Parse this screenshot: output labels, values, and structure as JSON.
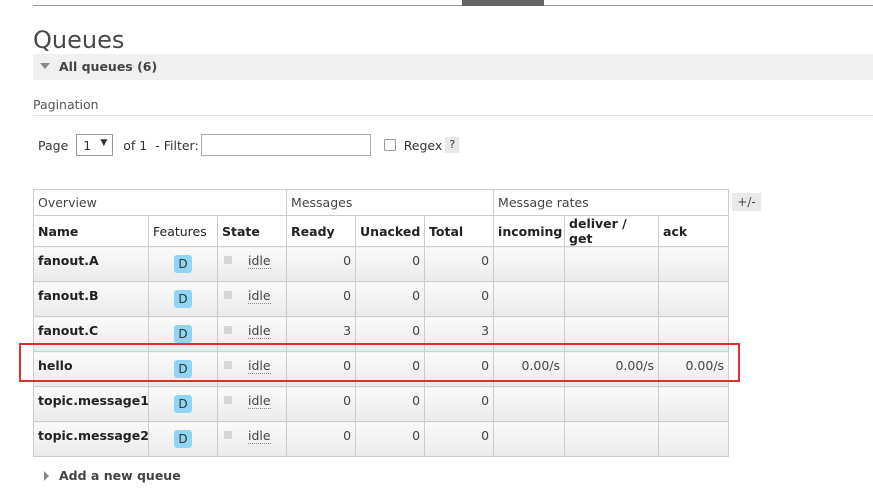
{
  "page_title": "Queues",
  "section": {
    "label": "All queues (6)"
  },
  "pagination": {
    "title": "Pagination",
    "page_label": "Page",
    "page_value": "1",
    "of_label": "of 1",
    "filter_label": "- Filter:",
    "filter_value": "",
    "regex_label": "Regex",
    "help_label": "?"
  },
  "table": {
    "groups": [
      "Overview",
      "Messages",
      "Message rates"
    ],
    "columns": [
      "Name",
      "Features",
      "State",
      "Ready",
      "Unacked",
      "Total",
      "incoming",
      "deliver / get",
      "ack"
    ],
    "rows": [
      {
        "name": "fanout.A",
        "feature": "D",
        "state": "idle",
        "ready": "0",
        "unacked": "0",
        "total": "0",
        "incoming": "",
        "deliver": "",
        "ack": ""
      },
      {
        "name": "fanout.B",
        "feature": "D",
        "state": "idle",
        "ready": "0",
        "unacked": "0",
        "total": "0",
        "incoming": "",
        "deliver": "",
        "ack": ""
      },
      {
        "name": "fanout.C",
        "feature": "D",
        "state": "idle",
        "ready": "3",
        "unacked": "0",
        "total": "3",
        "incoming": "",
        "deliver": "",
        "ack": ""
      },
      {
        "name": "hello",
        "feature": "D",
        "state": "idle",
        "ready": "0",
        "unacked": "0",
        "total": "0",
        "incoming": "0.00/s",
        "deliver": "0.00/s",
        "ack": "0.00/s"
      },
      {
        "name": "topic.message1",
        "feature": "D",
        "state": "idle",
        "ready": "0",
        "unacked": "0",
        "total": "0",
        "incoming": "",
        "deliver": "",
        "ack": ""
      },
      {
        "name": "topic.message2",
        "feature": "D",
        "state": "idle",
        "ready": "0",
        "unacked": "0",
        "total": "0",
        "incoming": "",
        "deliver": "",
        "ack": ""
      }
    ],
    "toggle_columns_label": "+/-"
  },
  "add_queue": {
    "label": "Add a new queue"
  },
  "colors": {
    "highlight": "#e0302e",
    "feature_badge": "#8fd6f5"
  },
  "icons": {
    "section_toggle": "triangle-down-icon",
    "add_toggle": "triangle-right-icon"
  }
}
